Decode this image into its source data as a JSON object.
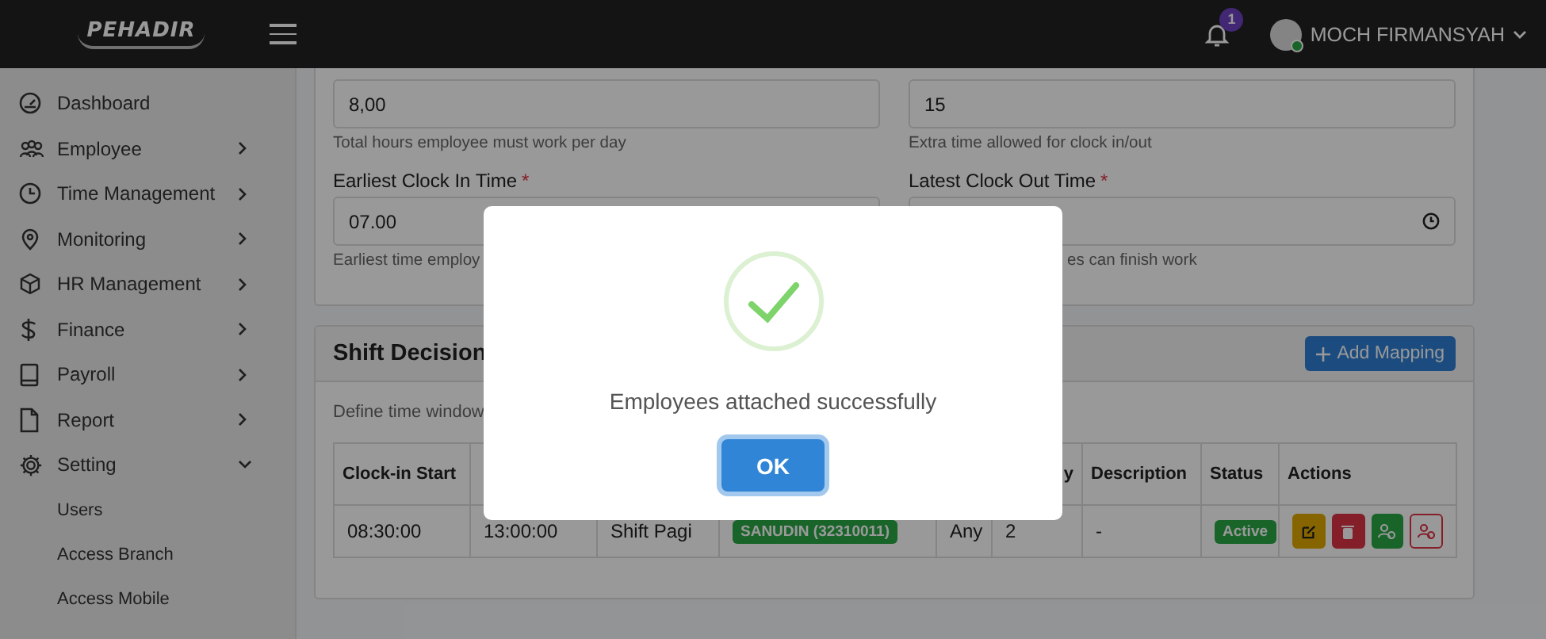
{
  "header": {
    "logo": "PEHADIR",
    "notification_count": "1",
    "user_name": "MOCH FIRMANSYAH",
    "user_online": true
  },
  "sidebar": {
    "items": [
      {
        "label": "Dashboard"
      },
      {
        "label": "Employee",
        "expanded": false
      },
      {
        "label": "Time Management",
        "expanded": false
      },
      {
        "label": "Monitoring",
        "expanded": false
      },
      {
        "label": "HR Management",
        "expanded": false
      },
      {
        "label": "Finance",
        "expanded": false
      },
      {
        "label": "Payroll",
        "expanded": false
      },
      {
        "label": "Report",
        "expanded": false
      },
      {
        "label": "Setting",
        "expanded": true,
        "children": [
          {
            "label": "Users"
          },
          {
            "label": "Access Branch"
          },
          {
            "label": "Access Mobile"
          }
        ]
      }
    ]
  },
  "form": {
    "fields": [
      {
        "value": "8,00",
        "help": "Total hours employee must work per day"
      },
      {
        "value": "15",
        "help": "Extra time allowed for clock in/out"
      },
      {
        "label": "Earliest Clock In Time",
        "required_mark": "*",
        "value": "07.00",
        "help": "Earliest time employ"
      },
      {
        "label": "Latest Clock Out Time",
        "required_mark": "*",
        "help": "es can finish work",
        "kind": "time"
      }
    ]
  },
  "shift_mapping": {
    "title": "Shift Decision",
    "add_button": "Add Mapping",
    "description": "Define time window",
    "table": {
      "columns": [
        "Clock-in Start",
        "",
        "",
        "",
        "",
        "y",
        "Description",
        "Status",
        "Actions"
      ],
      "rows": [
        {
          "cells": [
            "08:30:00",
            "13:00:00",
            "Shift Pagi",
            "",
            "Any",
            "2",
            "-"
          ],
          "employees": [
            "SANUDIN (32310011)"
          ],
          "status": "Active",
          "actions": [
            {
              "kind": "edit"
            },
            {
              "kind": "delete"
            },
            {
              "kind": "assign"
            },
            {
              "kind": "unassign"
            }
          ]
        }
      ]
    }
  },
  "dialog": {
    "message": "Employees attached successfully",
    "button": "OK"
  }
}
